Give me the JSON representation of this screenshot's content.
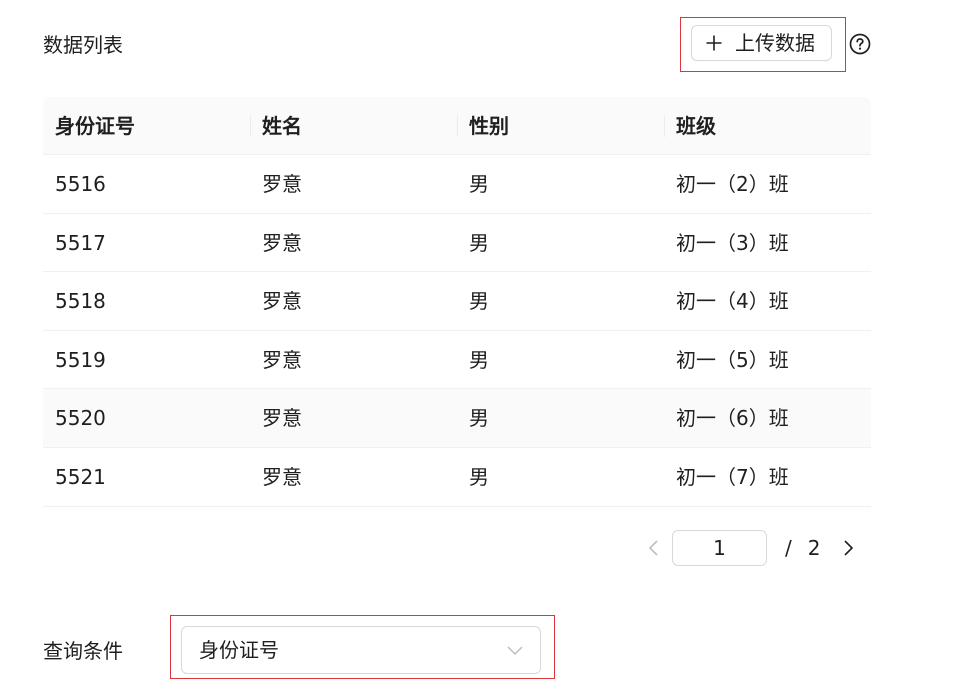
{
  "data_list": {
    "title": "数据列表",
    "upload_button": {
      "label": "上传数据",
      "icon": "plus-icon"
    },
    "help_icon": "question-circle-icon"
  },
  "table": {
    "columns": [
      "身份证号",
      "姓名",
      "性别",
      "班级"
    ],
    "rows": [
      [
        "5516",
        "罗意",
        "男",
        "初一（2）班"
      ],
      [
        "5517",
        "罗意",
        "男",
        "初一（3）班"
      ],
      [
        "5518",
        "罗意",
        "男",
        "初一（4）班"
      ],
      [
        "5519",
        "罗意",
        "男",
        "初一（5）班"
      ],
      [
        "5520",
        "罗意",
        "男",
        "初一（6）班"
      ],
      [
        "5521",
        "罗意",
        "男",
        "初一（7）班"
      ]
    ],
    "hovered_row_index": 4
  },
  "pagination": {
    "current_page": "1",
    "separator": "/",
    "total_pages": "2"
  },
  "query": {
    "label": "查询条件",
    "selected": "身份证号"
  },
  "colors": {
    "highlight_border": "#d9363e",
    "header_bg": "#fafafa",
    "border": "#d9d9d9",
    "text": "#1f1f1f"
  }
}
